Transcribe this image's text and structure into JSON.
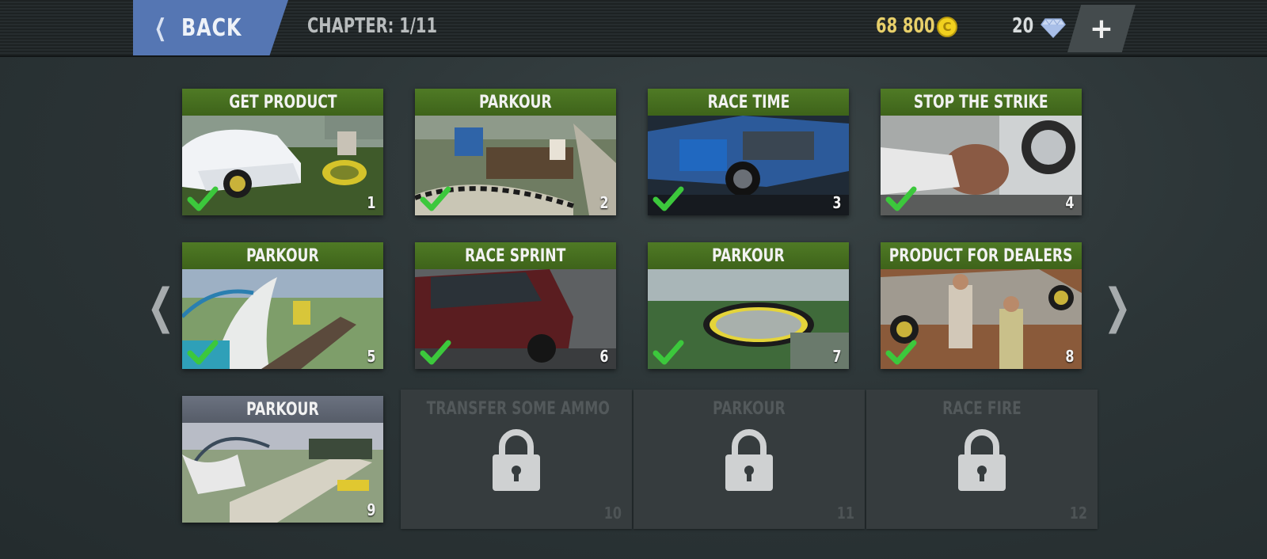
{
  "header": {
    "back_label": "BACK",
    "chapter_label": "CHAPTER: 1/11",
    "coins": "68 800",
    "gems": "20",
    "add_button": "+"
  },
  "nav": {
    "prev": "❮",
    "next": "❯"
  },
  "levels": [
    {
      "title": "GET PRODUCT",
      "number": "1",
      "completed": true,
      "locked": false
    },
    {
      "title": "PARKOUR",
      "number": "2",
      "completed": true,
      "locked": false
    },
    {
      "title": "RACE TIME",
      "number": "3",
      "completed": true,
      "locked": false
    },
    {
      "title": "STOP THE STRIKE",
      "number": "4",
      "completed": true,
      "locked": false
    },
    {
      "title": "PARKOUR",
      "number": "5",
      "completed": true,
      "locked": false
    },
    {
      "title": "RACE SPRINT",
      "number": "6",
      "completed": true,
      "locked": false
    },
    {
      "title": "PARKOUR",
      "number": "7",
      "completed": true,
      "locked": false
    },
    {
      "title": "PRODUCT FOR DEALERS",
      "number": "8",
      "completed": true,
      "locked": false
    },
    {
      "title": "PARKOUR",
      "number": "9",
      "completed": false,
      "locked": false
    },
    {
      "title": "TRANSFER SOME AMMO",
      "number": "10",
      "completed": false,
      "locked": true
    },
    {
      "title": "PARKOUR",
      "number": "11",
      "completed": false,
      "locked": true
    },
    {
      "title": "RACE FIRE",
      "number": "12",
      "completed": false,
      "locked": true
    }
  ],
  "colors": {
    "back_button": "#5576b3",
    "title_bar": "#4f7a25",
    "check": "#3cc83c",
    "coin": "#f1d01e"
  }
}
